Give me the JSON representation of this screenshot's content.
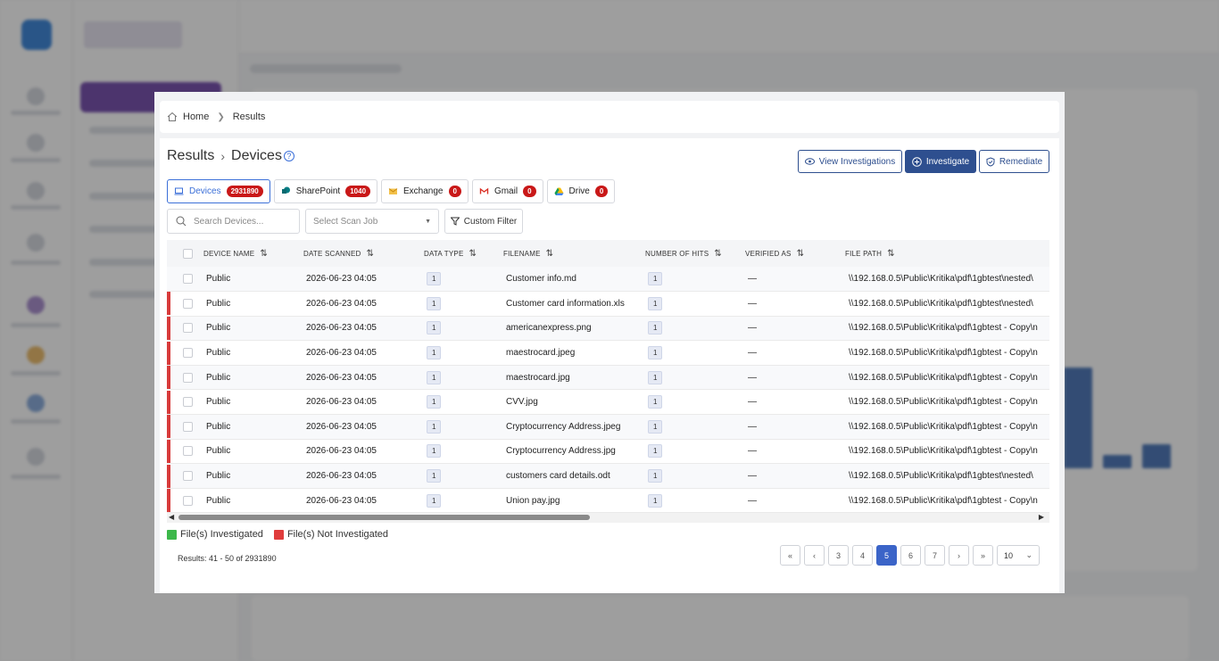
{
  "breadcrumb": {
    "home": "Home",
    "current": "Results"
  },
  "header": {
    "title_part1": "Results",
    "title_part2": "Devices"
  },
  "actions": {
    "view_investigations": "View Investigations",
    "investigate": "Investigate",
    "remediate": "Remediate"
  },
  "tabs": [
    {
      "label": "Devices",
      "count": "2931890",
      "active": true
    },
    {
      "label": "SharePoint",
      "count": "1040"
    },
    {
      "label": "Exchange",
      "count": "0"
    },
    {
      "label": "Gmail",
      "count": "0"
    },
    {
      "label": "Drive",
      "count": "0"
    }
  ],
  "filters": {
    "search_placeholder": "Search Devices...",
    "scan_job_placeholder": "Select Scan Job",
    "custom_filter": "Custom Filter"
  },
  "table": {
    "columns": [
      "DEVICE NAME",
      "DATE SCANNED",
      "DATA TYPE",
      "FILENAME",
      "NUMBER OF HITS",
      "VERIFIED AS",
      "FILE PATH"
    ],
    "rows": [
      {
        "device": "Public",
        "date": "2026-06-23 04:05",
        "type": "1",
        "filename": "Customer info.md",
        "hits": "1",
        "verified": "—",
        "path": "\\\\192.168.0.5\\Public\\Kritika\\pdf\\1gbtest\\nested\\",
        "flag": ""
      },
      {
        "device": "Public",
        "date": "2026-06-23 04:05",
        "type": "1",
        "filename": "Customer card information.xls",
        "hits": "1",
        "verified": "—",
        "path": "\\\\192.168.0.5\\Public\\Kritika\\pdf\\1gbtest\\nested\\",
        "flag": "red"
      },
      {
        "device": "Public",
        "date": "2026-06-23 04:05",
        "type": "1",
        "filename": "americanexpress.png",
        "hits": "1",
        "verified": "—",
        "path": "\\\\192.168.0.5\\Public\\Kritika\\pdf\\1gbtest - Copy\\n",
        "flag": "red"
      },
      {
        "device": "Public",
        "date": "2026-06-23 04:05",
        "type": "1",
        "filename": "maestrocard.jpeg",
        "hits": "1",
        "verified": "—",
        "path": "\\\\192.168.0.5\\Public\\Kritika\\pdf\\1gbtest - Copy\\n",
        "flag": "red"
      },
      {
        "device": "Public",
        "date": "2026-06-23 04:05",
        "type": "1",
        "filename": "maestrocard.jpg",
        "hits": "1",
        "verified": "—",
        "path": "\\\\192.168.0.5\\Public\\Kritika\\pdf\\1gbtest - Copy\\n",
        "flag": "red"
      },
      {
        "device": "Public",
        "date": "2026-06-23 04:05",
        "type": "1",
        "filename": "CVV.jpg",
        "hits": "1",
        "verified": "—",
        "path": "\\\\192.168.0.5\\Public\\Kritika\\pdf\\1gbtest - Copy\\n",
        "flag": "red"
      },
      {
        "device": "Public",
        "date": "2026-06-23 04:05",
        "type": "1",
        "filename": "Cryptocurrency Address.jpeg",
        "hits": "1",
        "verified": "—",
        "path": "\\\\192.168.0.5\\Public\\Kritika\\pdf\\1gbtest - Copy\\n",
        "flag": "red"
      },
      {
        "device": "Public",
        "date": "2026-06-23 04:05",
        "type": "1",
        "filename": "Cryptocurrency Address.jpg",
        "hits": "1",
        "verified": "—",
        "path": "\\\\192.168.0.5\\Public\\Kritika\\pdf\\1gbtest - Copy\\n",
        "flag": "red"
      },
      {
        "device": "Public",
        "date": "2026-06-23 04:05",
        "type": "1",
        "filename": "customers card details.odt",
        "hits": "1",
        "verified": "—",
        "path": "\\\\192.168.0.5\\Public\\Kritika\\pdf\\1gbtest\\nested\\",
        "flag": "red"
      },
      {
        "device": "Public",
        "date": "2026-06-23 04:05",
        "type": "1",
        "filename": "Union pay.jpg",
        "hits": "1",
        "verified": "—",
        "path": "\\\\192.168.0.5\\Public\\Kritika\\pdf\\1gbtest - Copy\\n",
        "flag": "red"
      }
    ]
  },
  "legend": {
    "investigated": "File(s) Investigated",
    "not_investigated": "File(s) Not Investigated",
    "investigated_color": "#3cb84a",
    "not_investigated_color": "#e03c3c"
  },
  "pagination": {
    "summary": "Results: 41 - 50 of 2931890",
    "pages": [
      "3",
      "4",
      "5",
      "6",
      "7"
    ],
    "current": "5",
    "page_size": "10"
  },
  "colors": {
    "accent": "#2e4f8f",
    "flag_red": "#d83b3b",
    "badge": "#c91818"
  }
}
